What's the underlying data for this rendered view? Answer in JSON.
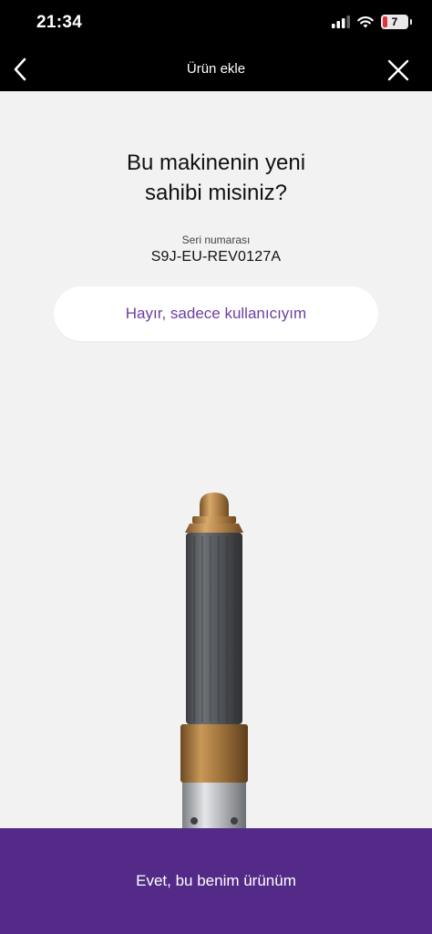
{
  "status_bar": {
    "time": "21:34",
    "battery_level": "7",
    "icons": [
      "signal-icon",
      "wifi-icon",
      "battery-icon"
    ]
  },
  "nav": {
    "title": "Ürün ekle",
    "back_icon": "chevron-left-icon",
    "close_icon": "close-icon"
  },
  "main": {
    "question_line1": "Bu makinenin yeni",
    "question_line2": "sahibi misiniz?",
    "serial_label": "Seri numarası",
    "serial_value": "S9J-EU-REV0127A",
    "no_button_label": "Hayır, sadece kullanıcıyım"
  },
  "footer": {
    "yes_button_label": "Evet, bu benim ürünüm"
  },
  "colors": {
    "accent": "#532a87",
    "link": "#6b3fa0",
    "background": "#f2f2f2",
    "header": "#000000"
  }
}
